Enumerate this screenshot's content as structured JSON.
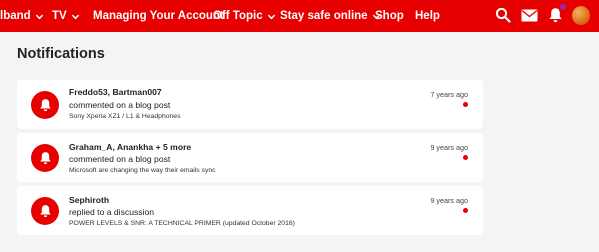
{
  "nav": {
    "items": [
      {
        "label": "lband",
        "has_menu": true
      },
      {
        "label": "TV",
        "has_menu": true
      },
      {
        "label": "Managing Your Account",
        "has_menu": false
      },
      {
        "label": "Off Topic",
        "has_menu": true
      },
      {
        "label": "Stay safe online",
        "has_menu": true
      },
      {
        "label": "Shop",
        "has_menu": false
      },
      {
        "label": "Help",
        "has_menu": false
      }
    ],
    "icons": [
      "search-icon",
      "mail-icon",
      "bell-icon",
      "avatar"
    ],
    "has_unread_notification": true
  },
  "page": {
    "title": "Notifications"
  },
  "notifications": [
    {
      "who": "Freddo53, Bartman007",
      "action": "commented on a blog post",
      "subject": "Sony Xperia XZ1 / L1 & Headphones",
      "time": "7 years ago",
      "unread": true
    },
    {
      "who": "Graham_A, Anankha + 5 more",
      "action": "commented on a blog post",
      "subject": "Microsoft are changing the way their emails sync",
      "time": "9 years ago",
      "unread": true
    },
    {
      "who": "Sephiroth",
      "action": "replied to a discussion",
      "subject": "POWER LEVELS & SNR: A TECHNICAL PRIMER (updated October 2016)",
      "time": "9 years ago",
      "unread": true
    }
  ],
  "colors": {
    "brand": "#e60000",
    "background": "#f4f4f4",
    "card": "#ffffff",
    "avatar": "#e07b22",
    "notification_dot": "#9c2aa0"
  }
}
